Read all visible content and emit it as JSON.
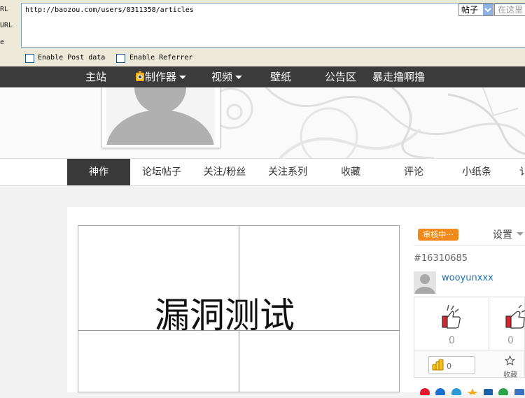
{
  "hackbar": {
    "labels": [
      "RL",
      "URL",
      "e"
    ],
    "url_value": "http://baozou.com/users/8311358/articles",
    "post_data_label": "Enable Post data",
    "referrer_label": "Enable Referrer"
  },
  "topnav": {
    "items": [
      "主站",
      "制作器",
      "视频",
      "壁纸",
      "公告区",
      "暴走撸啊撸"
    ],
    "search_scope": "帖子",
    "search_placeholder": "在这里"
  },
  "tabs": [
    "神作",
    "论坛帖子",
    "关注/粉丝",
    "关注系列",
    "收藏",
    "评论",
    "小纸条",
    "讠"
  ],
  "post": {
    "image_text": "漏洞测试",
    "status_badge": "审核中···",
    "settings_label": "设置",
    "id": "#16310685",
    "author": "wooyunxxx",
    "upvotes": "0",
    "downvotes": "0",
    "coins": "0",
    "favorite_label": "收藏"
  },
  "colors": {
    "nav_bg": "#3b3b3b",
    "active_tab": "#3a3a3a",
    "badge": "#f08a1a",
    "link": "#1f6fb5",
    "vote_red": "#d9232d"
  }
}
